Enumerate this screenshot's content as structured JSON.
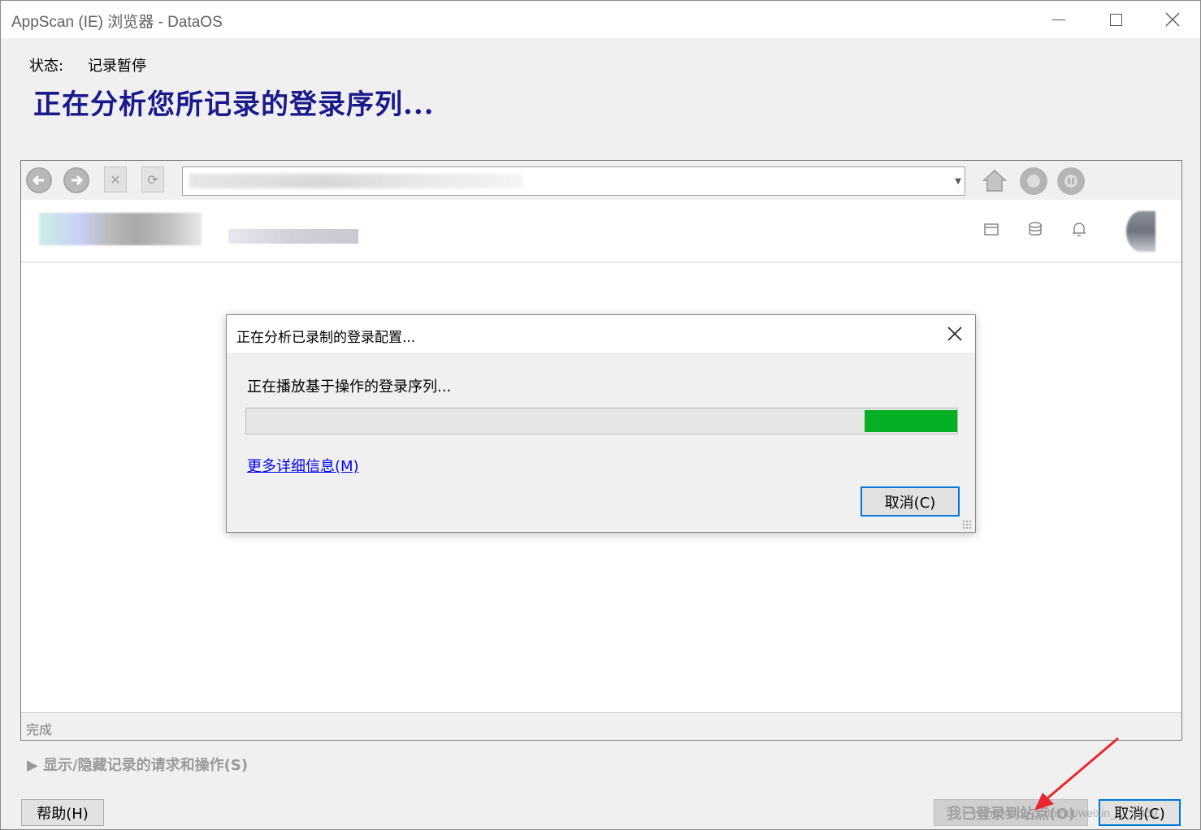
{
  "window": {
    "title": "AppScan (IE) 浏览器 - DataOS"
  },
  "status": {
    "label": "状态:",
    "value": "记录暂停"
  },
  "heading": "正在分析您所记录的登录序列...",
  "browser": {
    "status_text": "完成"
  },
  "dialog": {
    "title": "正在分析已录制的登录配置...",
    "message": "正在播放基于操作的登录序列...",
    "progress_fraction": 0.13,
    "progress_offset": 0.87,
    "details_link": "更多详细信息(M)",
    "cancel_label": "取消(C)"
  },
  "bottom": {
    "toggle_label": "▶ 显示/隐藏记录的请求和操作(S)",
    "help_label": "帮助(H)",
    "next_label": "我已登录到站点(O)",
    "cancel_label": "取消(C)",
    "watermark": "https://blog.csdn.net/weixin_..._7369"
  },
  "colors": {
    "heading": "#1a1a8c",
    "progress_fill": "#06b025",
    "focus_border": "#0078d7",
    "link": "#0000ee",
    "annotation_arrow": "#e8262b"
  },
  "icons": {
    "back": "arrow-left-circle-icon",
    "forward": "arrow-right-circle-icon",
    "stop": "stop-x-icon",
    "refresh": "refresh-icon",
    "home": "home-icon",
    "record": "record-icon",
    "pause": "pause-icon"
  }
}
